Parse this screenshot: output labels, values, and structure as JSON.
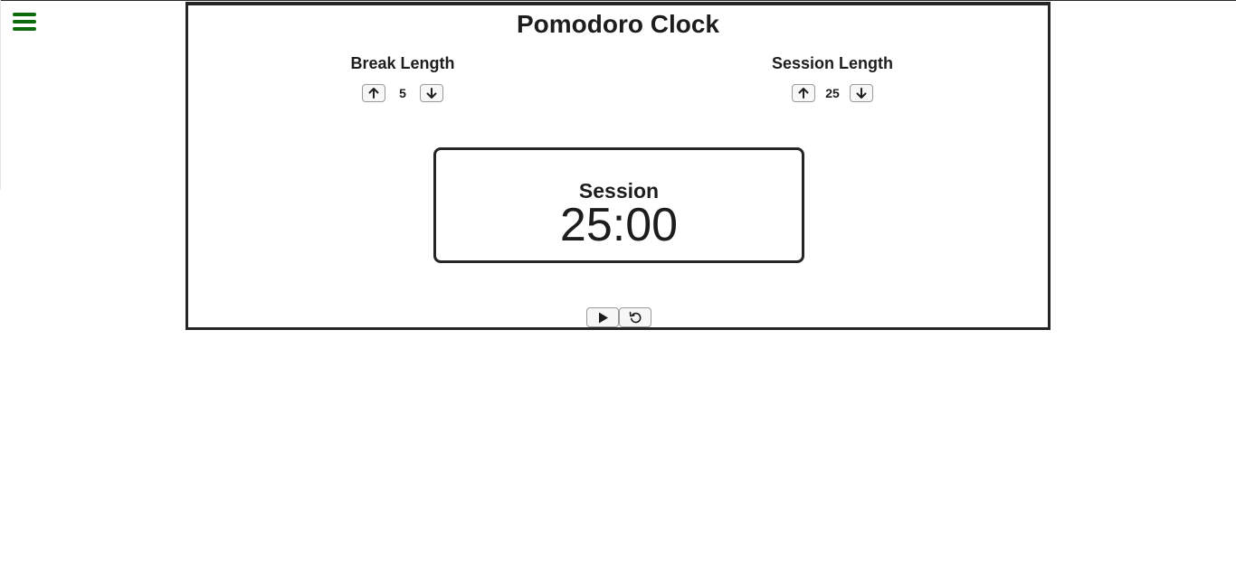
{
  "app": {
    "title": "Pomodoro Clock",
    "accent_color": "#0d6b0d",
    "menu_icon": "hamburger-menu-icon"
  },
  "break_control": {
    "label": "Break Length",
    "value": "5",
    "increment_icon": "arrow-up-icon",
    "decrement_icon": "arrow-down-icon"
  },
  "session_control": {
    "label": "Session Length",
    "value": "25",
    "increment_icon": "arrow-up-icon",
    "decrement_icon": "arrow-down-icon"
  },
  "timer": {
    "mode": "Session",
    "time": "25:00"
  },
  "actions": {
    "play_icon": "play-icon",
    "reset_icon": "reset-icon"
  }
}
